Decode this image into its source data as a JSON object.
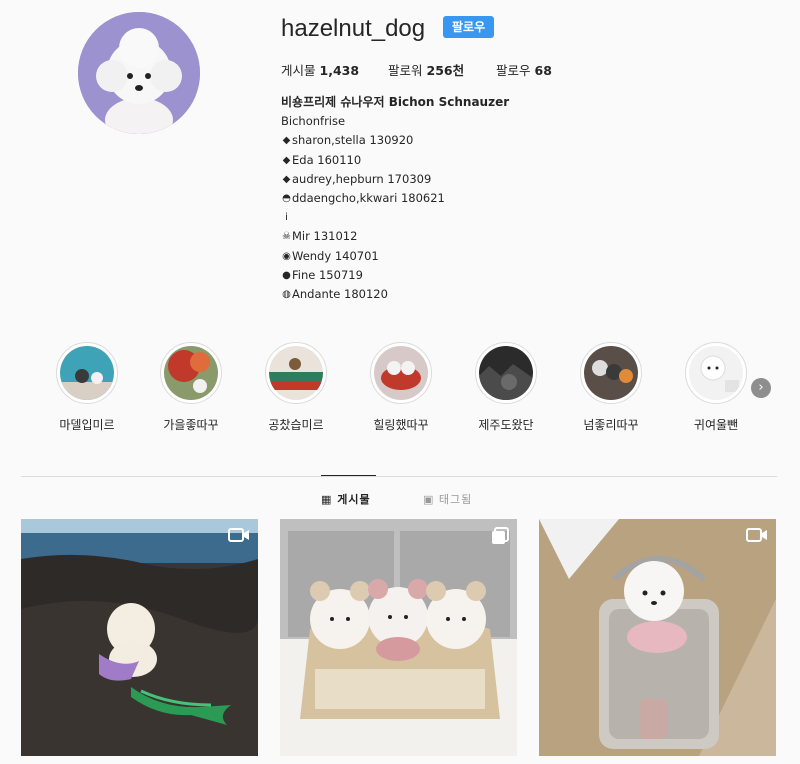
{
  "profile": {
    "username": "hazelnut_dog",
    "follow_label": "팔로우",
    "stats": {
      "posts_label": "게시물",
      "posts_value": "1,438",
      "followers_label": "팔로워",
      "followers_value": "256천",
      "following_label": "팔로우",
      "following_value": "68"
    },
    "bio": {
      "name": "비숑프리제 슈나우저 Bichon Schnauzer",
      "lines": [
        "Bichonfrise",
        "sharon,stella 130920",
        "Eda 160110",
        "audrey,hepburn 170309",
        "ddaengcho,kkwari 180621",
        "",
        "Mir 131012",
        "Wendy 140701",
        "Fine 150719",
        "Andante 180120"
      ]
    }
  },
  "highlights": [
    {
      "label": "마델입미르"
    },
    {
      "label": "가을좋따꾸"
    },
    {
      "label": "공찼습미르"
    },
    {
      "label": "힐링했따꾸"
    },
    {
      "label": "제주도왔단"
    },
    {
      "label": "넘좋리따꾸"
    },
    {
      "label": "귀여울뺀"
    }
  ],
  "tabs": {
    "posts_label": "게시물",
    "tagged_label": "태그됨"
  },
  "colors": {
    "follow_button": "#3897f0",
    "avatar_bg": "#9c92cf"
  }
}
